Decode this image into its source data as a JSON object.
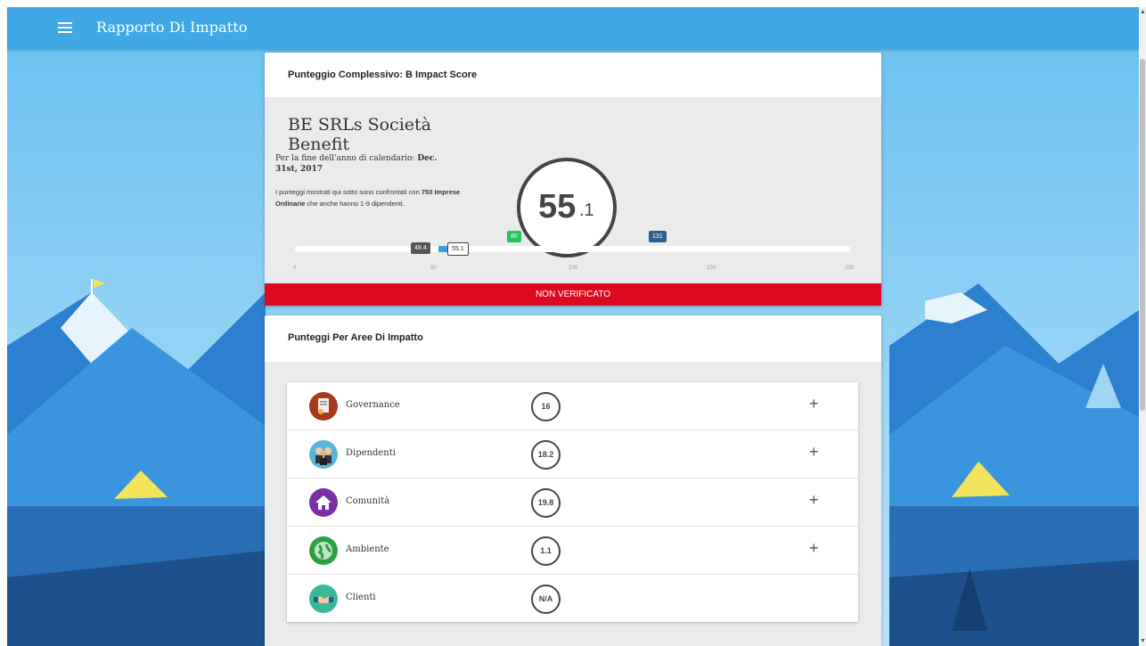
{
  "topbar": {
    "title": "Rapporto Di Impatto",
    "menu_icon": "menu-icon"
  },
  "overall": {
    "header": "Punteggio Complessivo: B Impact Score",
    "company": "BE SRLs Società Benefit",
    "period_prefix": "Per la fine dell'anno di calendario: ",
    "period_date": "Dec. 31st, 2017",
    "compare_prefix": "I punteggi mostrati qui sotto sono confrontati con ",
    "compare_bold": "750 Imprese Ordinarie",
    "compare_suffix": " che anche hanno 1-9 dipendenti.",
    "score_main": "55",
    "score_dec": ".1",
    "slider": {
      "average_label": "48.4",
      "score_label": "55.1",
      "marker_green": "80",
      "marker_blue": "131",
      "ticks": [
        "0",
        "50",
        "100",
        "150",
        "200"
      ]
    },
    "status": "NON VERIFICATO"
  },
  "areas": {
    "header": "Punteggi Per Aree Di Impatto",
    "items": [
      {
        "label": "Governance",
        "score": "16",
        "icon": "governance-icon",
        "color": "#a63a1f",
        "expandable": true
      },
      {
        "label": "Dipendenti",
        "score": "18.2",
        "icon": "workers-icon",
        "color": "#5ab5d8",
        "expandable": true
      },
      {
        "label": "Comunità",
        "score": "19.8",
        "icon": "community-icon",
        "color": "#7b2fa5",
        "expandable": true
      },
      {
        "label": "Ambiente",
        "score": "1.1",
        "icon": "environment-icon",
        "color": "#2f9e44",
        "expandable": true
      },
      {
        "label": "Clienti",
        "score": "N/A",
        "icon": "customers-icon",
        "color": "#3bb89a",
        "expandable": false
      }
    ]
  }
}
